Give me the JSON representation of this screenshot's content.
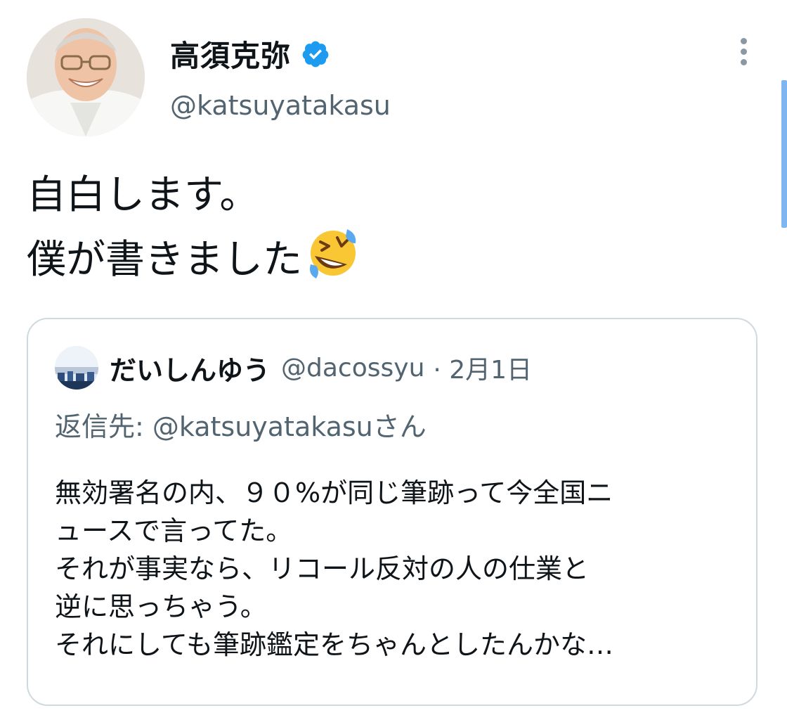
{
  "tweet": {
    "author": {
      "display_name": "高須克弥",
      "handle": "@katsuyatakasu",
      "verified": true,
      "verified_color": "#1d9bf0"
    },
    "text_lines": [
      "自白します。",
      "僕が書きました"
    ],
    "emoji": "rolling-on-the-floor-laughing"
  },
  "quoted_tweet": {
    "author": {
      "display_name": "だいしんゆう",
      "handle": "@dacossyu"
    },
    "date_line": "· 2月1日",
    "reply_to": "返信先: @katsuyatakasuさん",
    "body_lines": [
      "無効署名の内、９０%が同じ筆跡って今全国ニ",
      "ュースで言ってた。",
      "それが事実なら、リコール反対の人の仕業と",
      "逆に思っちゃう。",
      "それにしても筆跡鑑定をちゃんとしたんかな…"
    ]
  },
  "colors": {
    "text": "#0f1419",
    "secondary": "#536471",
    "border": "#cfd9de",
    "accent": "#1d9bf0"
  }
}
